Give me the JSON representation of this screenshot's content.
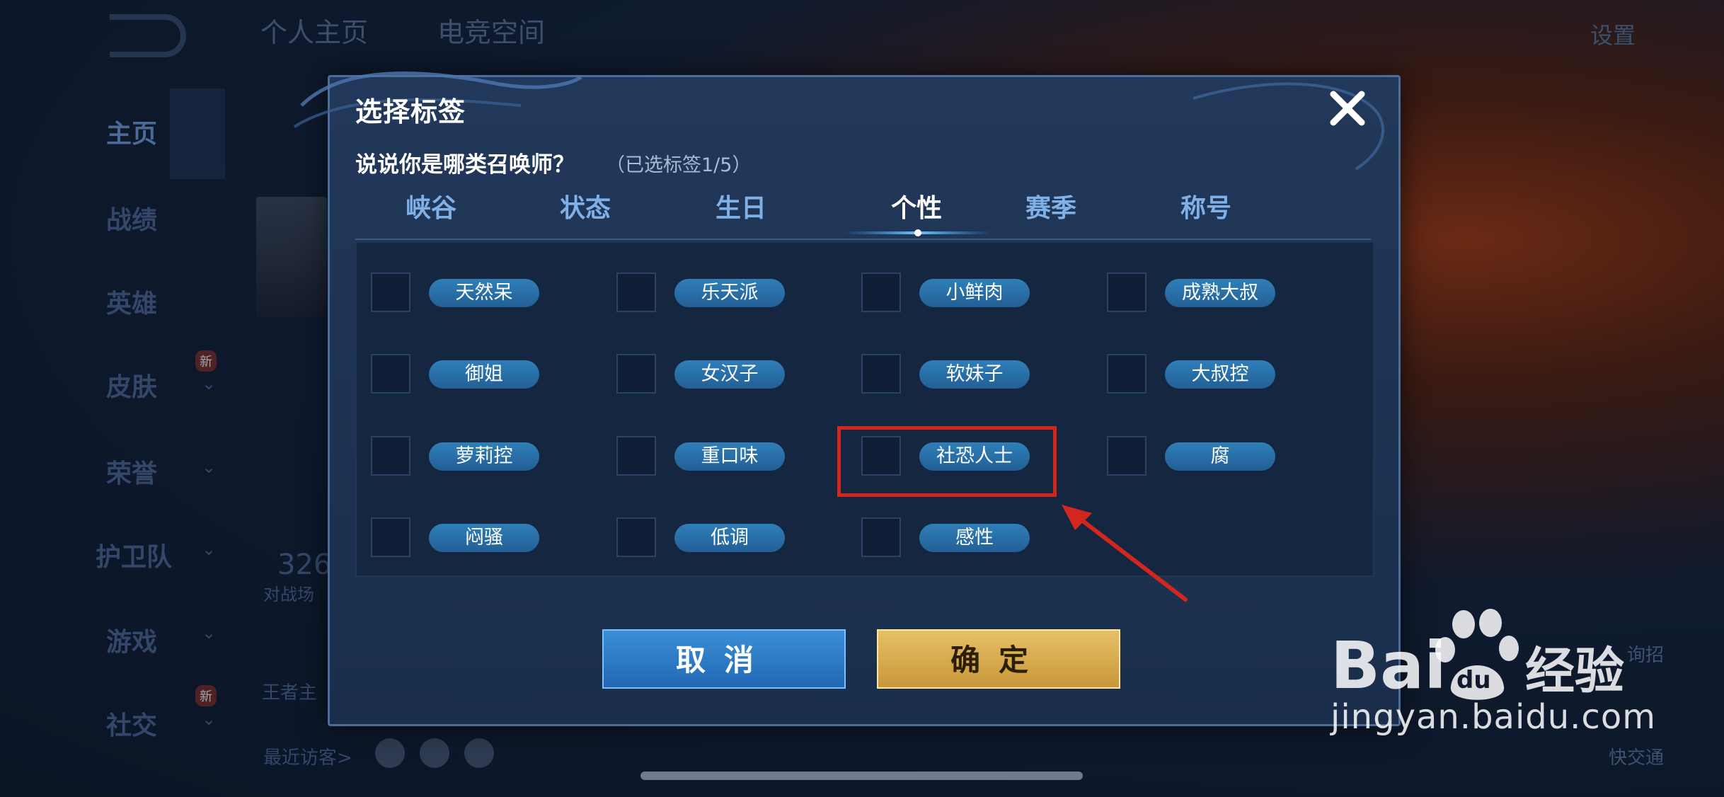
{
  "background": {
    "top_tabs": [
      "个人主页",
      "电竞空间"
    ],
    "settings": "设置",
    "side_items": [
      {
        "label": "主页",
        "active": true
      },
      {
        "label": "战绩"
      },
      {
        "label": "英雄"
      },
      {
        "label": "皮肤",
        "badge": "新"
      },
      {
        "label": "荣誉"
      },
      {
        "label": "护卫队"
      },
      {
        "label": "游戏"
      },
      {
        "label": "社交",
        "badge": "新"
      }
    ],
    "stat_number": "326",
    "stat_caption": "对战场",
    "caption_2": "王者主",
    "visitors": "最近访客>",
    "right_labels": [
      "询招",
      "快交通"
    ]
  },
  "dialog": {
    "title": "选择标签",
    "question": "说说你是哪类召唤师？",
    "selected_count": "（已选标签1/5）",
    "tabs": [
      "峡谷",
      "状态",
      "生日",
      "个性",
      "赛季",
      "称号"
    ],
    "active_tab": "个性",
    "tags": [
      [
        "天然呆",
        "乐天派",
        "小鲜肉",
        "成熟大叔"
      ],
      [
        "御姐",
        "女汉子",
        "软妹子",
        "大叔控"
      ],
      [
        "萝莉控",
        "重口味",
        "社恐人士",
        "腐"
      ],
      [
        "闷骚",
        "低调",
        "感性"
      ]
    ],
    "cancel_label": "取消",
    "confirm_label": "确定"
  },
  "watermark": {
    "brand": "Bai du 经验",
    "url": "jingyan.baidu.com"
  },
  "colors": {
    "accent_blue": "#2f7fb8",
    "confirm_gold": "#d9ad52",
    "highlight_red": "#d3261e"
  }
}
